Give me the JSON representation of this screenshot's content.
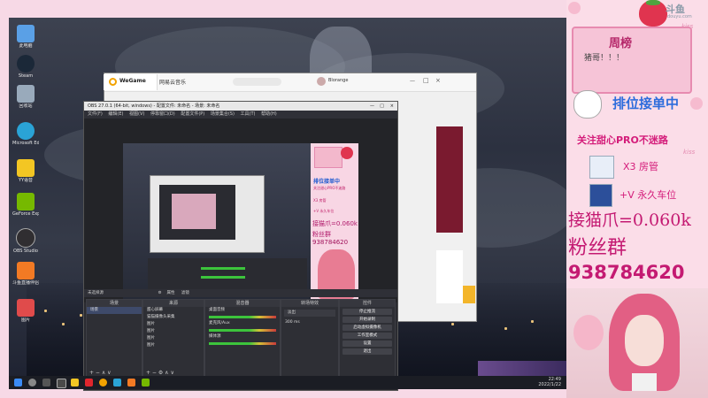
{
  "stream_overlay": {
    "logo": "斗鱼",
    "logo_url": "douyu.com",
    "board_title": "周榜",
    "board_content": "猪哥！！！",
    "kiss_label": "kiss",
    "order_title": "排位接单中",
    "follow_text": "关注甜心PRO不迷路",
    "x3_label": "X3 房管",
    "v_label": "+V 永久车位",
    "price_text": "接猫爪=0.060k",
    "fan_group_label": "粉丝群",
    "fan_group_number": "938784620"
  },
  "desktop": {
    "icons": [
      {
        "label": "此电脑",
        "icon": "computer-icon",
        "color": "#5aa0e6"
      },
      {
        "label": "Steam",
        "icon": "steam-icon",
        "color": "#1b2838"
      },
      {
        "label": "回收站",
        "icon": "recycle-bin-icon",
        "color": "#9ab"
      },
      {
        "label": "Microsoft Edge",
        "icon": "edge-icon",
        "color": "#2aa3d6"
      },
      {
        "label": "YY语音",
        "icon": "yy-icon",
        "color": "#f3c623"
      },
      {
        "label": "GeForce Experience",
        "icon": "geforce-icon",
        "color": "#76b900"
      },
      {
        "label": "OBS Studio",
        "icon": "obs-icon",
        "color": "#302e31"
      },
      {
        "label": "斗鱼直播伴侣",
        "icon": "douyu-icon",
        "color": "#f27a24"
      },
      {
        "label": "图片",
        "icon": "picture-icon",
        "color": "#e04b4b"
      }
    ]
  },
  "wegame": {
    "title": "WeGame"
  },
  "music_app": {
    "title": "网易云音乐",
    "user": "Blorange"
  },
  "obs": {
    "title": "OBS 27.0.1 (64-bit, windows) - 配置文件: 未命名 - 场景: 未命名",
    "menu": [
      "文件(F)",
      "编辑(E)",
      "视图(V)",
      "停靠窗口(D)",
      "配置文件(P)",
      "场景集合(S)",
      "工具(T)",
      "帮助(H)"
    ],
    "source_bar": [
      "未选择源",
      "属性",
      "滤镜"
    ],
    "docks": {
      "scenes": {
        "title": "场景",
        "items": [
          "场景"
        ]
      },
      "sources": {
        "title": "来源",
        "items": [
          "甜心屏幕",
          "猫猫摄像头采集",
          "图片",
          "图片",
          "图片",
          "图片"
        ]
      },
      "mixer": {
        "title": "混音器",
        "channels": [
          "桌面音频",
          "麦克风/Aux",
          "媒体源"
        ]
      },
      "transitions": {
        "title": "转场特效",
        "value": "淡出",
        "duration": "300 ms"
      },
      "controls": {
        "title": "控件",
        "buttons": [
          "停止推流",
          "开始录制",
          "启动虚拟摄像机",
          "工作室模式",
          "设置",
          "退出"
        ]
      }
    },
    "status": "LIVE: 00:00:00   REC: 00:00:00   CPU: 5.4%, 60.00 fps"
  },
  "taskbar": {
    "time": "22:49",
    "date": "2022/1/22"
  }
}
